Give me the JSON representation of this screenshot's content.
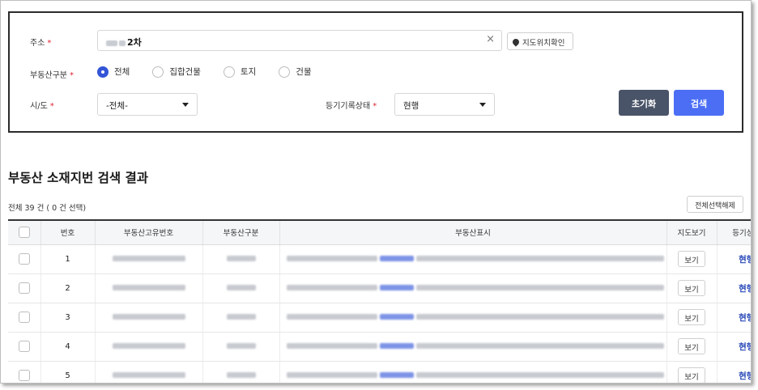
{
  "search": {
    "address_label": "주소",
    "address_value": "2차",
    "map_button_label": "지도위치확인",
    "type_label": "부동산구분",
    "type_options": [
      "전체",
      "집합건물",
      "토지",
      "건물"
    ],
    "type_selected": "전체",
    "sido_label": "시/도",
    "sido_value": "-전체-",
    "status_label": "등기기록상태",
    "status_value": "현행",
    "reset_label": "초기화",
    "search_label": "검색",
    "required_mark": "*"
  },
  "results": {
    "title": "부동산 소재지번 검색 결과",
    "count_text": "전체 39 건 ( 0 건 선택)",
    "deselect_label": "전체선택해제",
    "columns": [
      "",
      "번호",
      "부동산고유번호",
      "부동산구분",
      "부동산표시",
      "지도보기",
      "등기상태"
    ],
    "rows": [
      {
        "no": "1",
        "map": "보기",
        "status": "현행"
      },
      {
        "no": "2",
        "map": "보기",
        "status": "현행"
      },
      {
        "no": "3",
        "map": "보기",
        "status": "현행"
      },
      {
        "no": "4",
        "map": "보기",
        "status": "현행"
      },
      {
        "no": "5",
        "map": "보기",
        "status": "현행"
      }
    ]
  },
  "colors": {
    "primary": "#4b6ef5",
    "reset": "#4a5468",
    "radio_on": "#3355d6",
    "status_text": "#2747b7",
    "required": "#e0242f"
  },
  "icons": {
    "map_pin": "map-pin-icon",
    "clear": "close-icon",
    "dropdown": "chevron-down-icon"
  }
}
